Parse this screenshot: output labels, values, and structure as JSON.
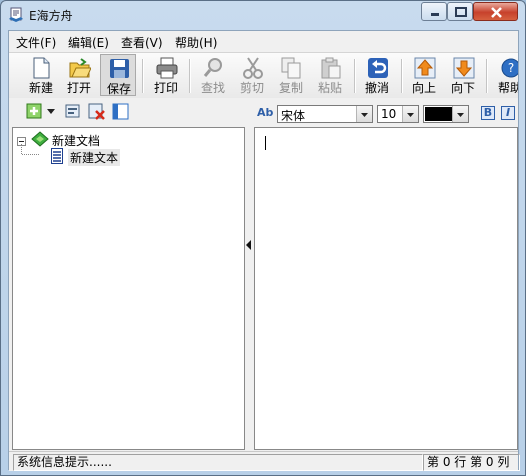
{
  "window": {
    "title": "E海方舟"
  },
  "menu": [
    {
      "label": "文件(F)"
    },
    {
      "label": "编辑(E)"
    },
    {
      "label": "查看(V)"
    },
    {
      "label": "帮助(H)"
    }
  ],
  "toolbar": {
    "new": "新建",
    "open": "打开",
    "save": "保存",
    "print": "打印",
    "find": "查找",
    "cut": "剪切",
    "copy": "复制",
    "paste": "粘贴",
    "undo": "撤消",
    "up": "向上",
    "down": "向下",
    "help": "帮助"
  },
  "tree": {
    "root": "新建文档",
    "child": "新建文本"
  },
  "format": {
    "style_label": "Ab",
    "font": "宋体",
    "size": "10",
    "color": "#000000",
    "bold": "B",
    "italic": "I"
  },
  "status": {
    "message": "系统信息提示......",
    "position": "第 0 行 第 0 列"
  }
}
